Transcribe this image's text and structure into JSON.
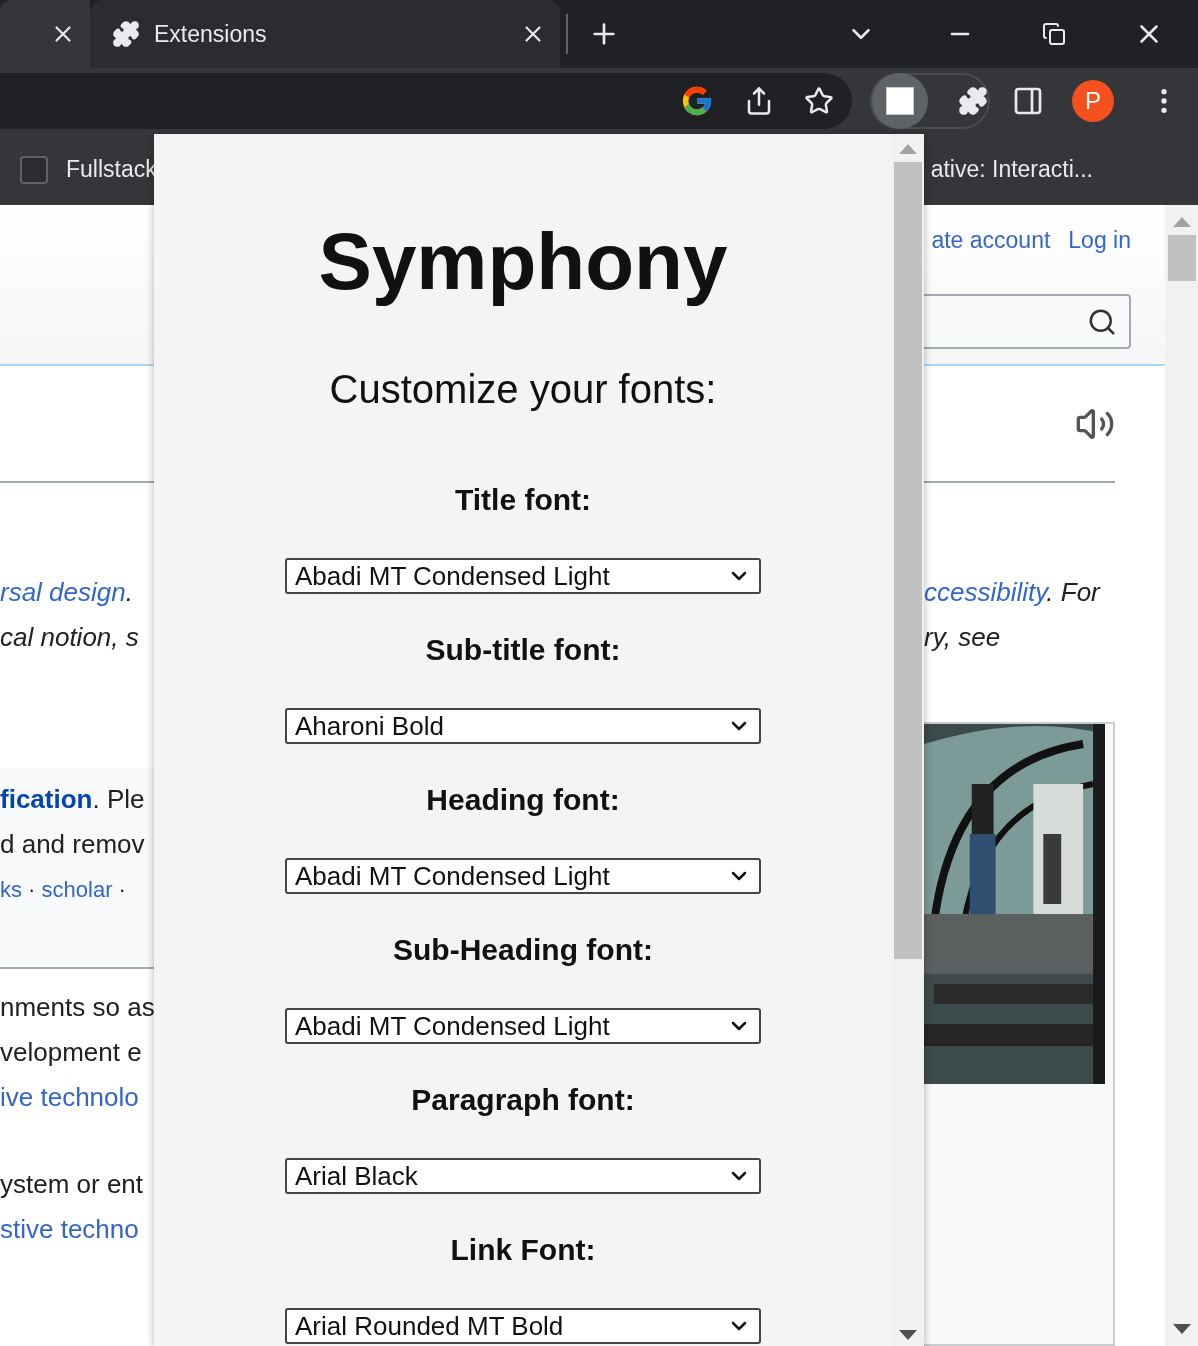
{
  "browser": {
    "tabs": [
      {
        "selected": true
      },
      {
        "title": "Extensions",
        "selected": false
      }
    ],
    "profile_initial": "P",
    "bookmarks": [
      "Fullstack",
      "ative: Interacti..."
    ]
  },
  "page": {
    "header_links": [
      "ate account",
      "Log in"
    ],
    "left_blocks": [
      {
        "kind": "plain",
        "lines": [
          {
            "kind": "italic",
            "parts": [
              {
                "text": "rsal design",
                "link": true
              },
              {
                "text": "."
              }
            ]
          },
          {
            "kind": "italic",
            "parts": [
              {
                "text": "cal notion, s"
              }
            ]
          }
        ]
      },
      {
        "kind": "notice",
        "lines": [
          {
            "kind": "normal",
            "parts": [
              {
                "text": "fication",
                "link": true,
                "bold": true
              },
              {
                "text": ". Ple"
              }
            ]
          },
          {
            "kind": "normal",
            "parts": [
              {
                "text": "d and remov"
              }
            ]
          },
          {
            "kind": "small",
            "parts": [
              {
                "text": "ks",
                "link": true
              },
              {
                "text": " · "
              },
              {
                "text": "scholar",
                "link": true
              },
              {
                "text": " ·"
              }
            ]
          }
        ]
      },
      {
        "kind": "plain",
        "lines": [
          {
            "kind": "normal",
            "parts": [
              {
                "text": "nments so as"
              }
            ]
          },
          {
            "kind": "normal",
            "parts": [
              {
                "text": "velopment e"
              }
            ]
          },
          {
            "kind": "normal",
            "parts": [
              {
                "text": "ive technolo",
                "link": true
              }
            ]
          }
        ]
      },
      {
        "kind": "plain",
        "lines": [
          {
            "kind": "normal",
            "parts": [
              {
                "text": "ystem or ent"
              }
            ]
          },
          {
            "kind": "normal",
            "parts": [
              {
                "text": "stive techno",
                "link": true
              }
            ]
          }
        ]
      }
    ],
    "right_lines": [
      {
        "kind": "italic",
        "parts": [
          {
            "text": "ccessibility",
            "link": true
          },
          {
            "text": ". For"
          }
        ]
      },
      {
        "kind": "italic",
        "parts": [
          {
            "text": "ry, see"
          }
        ]
      }
    ],
    "image": {
      "kind": "picture"
    }
  },
  "popup": {
    "title": "Symphony",
    "subtitle": "Customize your fonts:",
    "fields": [
      {
        "label": "Title font:",
        "value": "Abadi MT Condensed Light"
      },
      {
        "label": "Sub-title font:",
        "value": "Aharoni Bold"
      },
      {
        "label": "Heading font:",
        "value": "Abadi MT Condensed Light"
      },
      {
        "label": "Sub-Heading font:",
        "value": "Abadi MT Condensed Light"
      },
      {
        "label": "Paragraph font:",
        "value": "Arial Black"
      },
      {
        "label": "Link Font:",
        "value": "Arial Rounded MT Bold"
      }
    ]
  }
}
